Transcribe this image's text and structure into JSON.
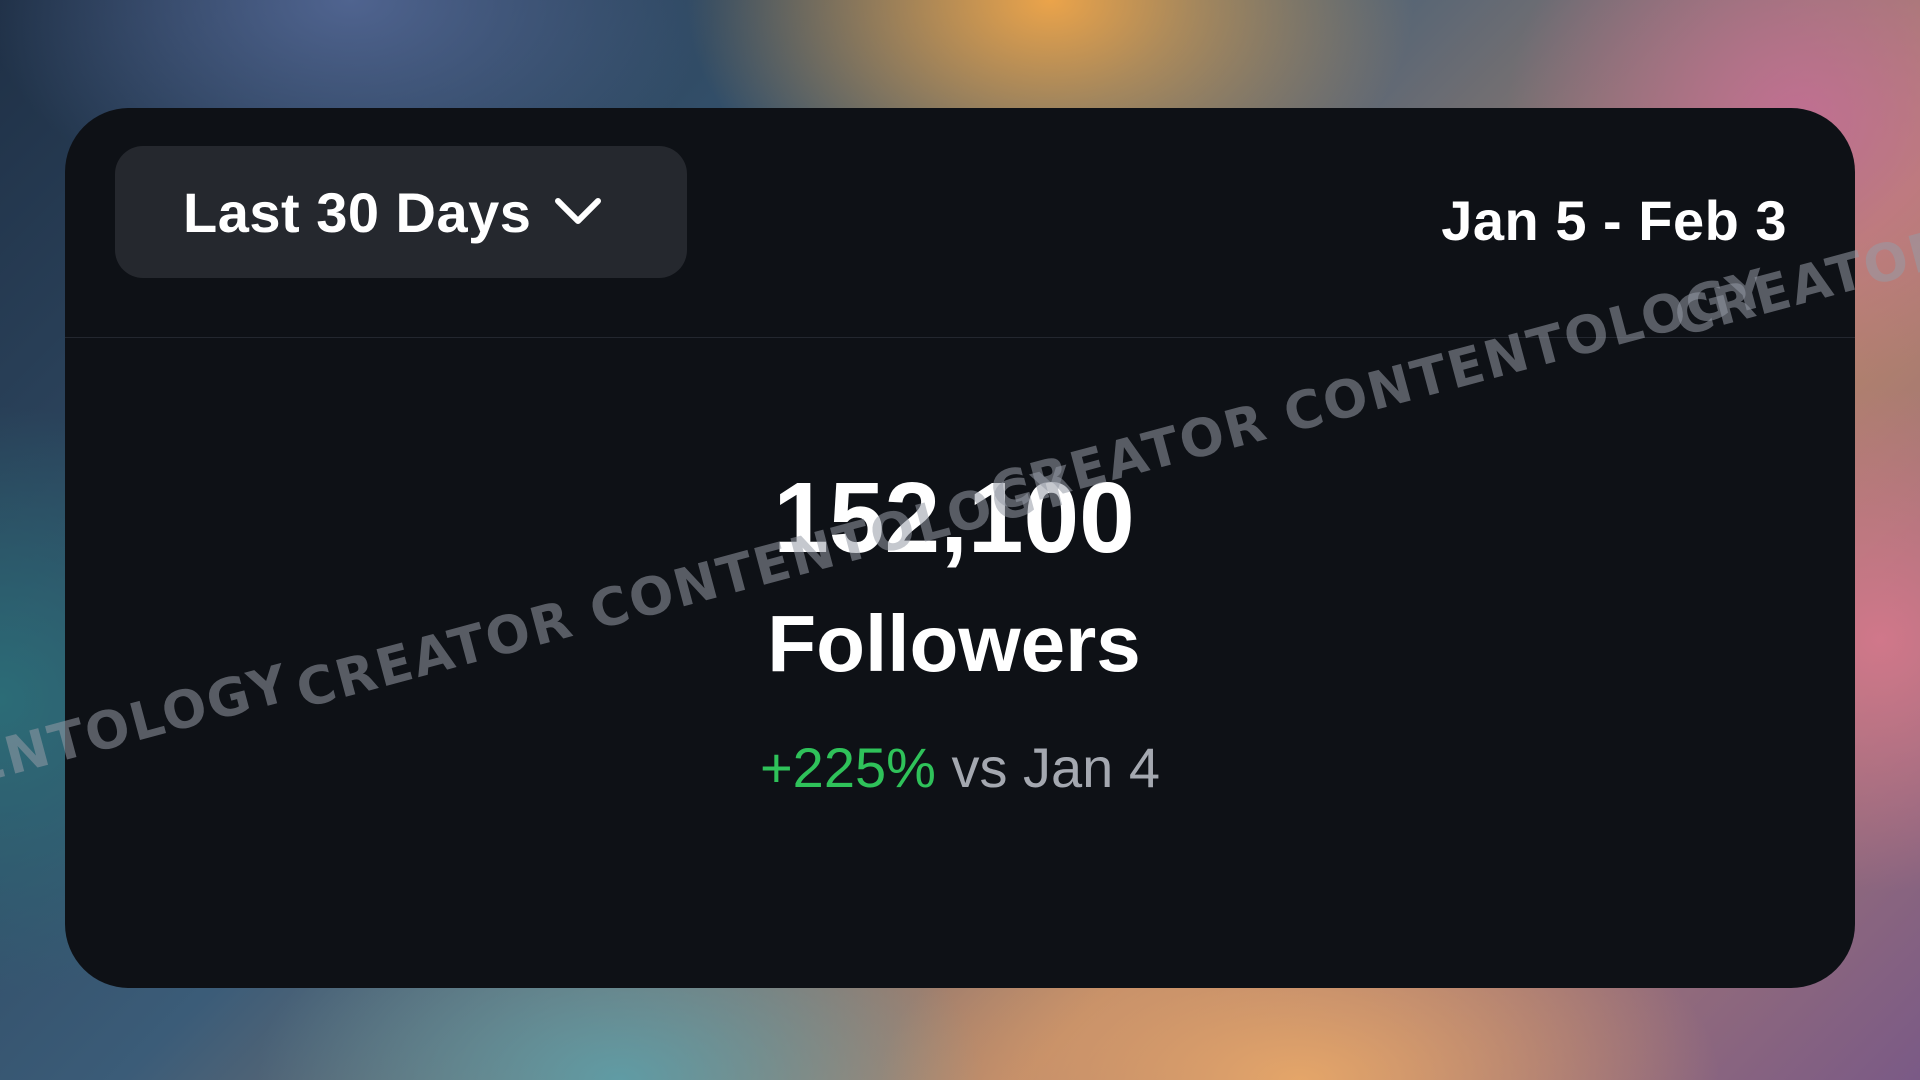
{
  "widget": {
    "range_selector": {
      "label": "Last 30 Days",
      "icon": "chevron-down-icon"
    },
    "date_range": "Jan 5 - Feb 3",
    "metric": {
      "value": "152,100",
      "label": "Followers"
    },
    "comparison": {
      "change": "+225%",
      "reference": "vs Jan 4"
    }
  },
  "watermark": {
    "segments": [
      "ENTOLOGY",
      "CREATOR CONTENTOLOGY",
      "CREATOR CONTENTOLOGY",
      "CREATOR"
    ]
  },
  "colors": {
    "card_background": "#0e1116",
    "dropdown_background": "#25282e",
    "positive_change": "#2fc25a",
    "muted_text": "#a4a8b0"
  }
}
